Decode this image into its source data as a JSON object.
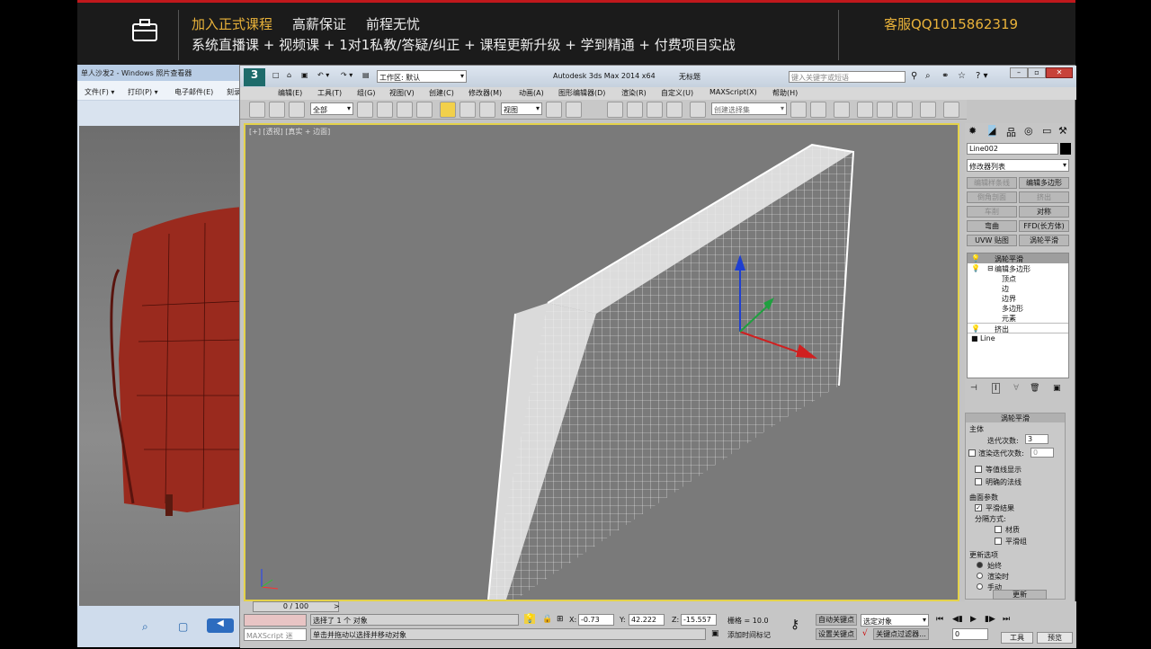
{
  "banner": {
    "line1": [
      "加入正式课程",
      "高薪保证",
      "前程无忧"
    ],
    "line2": "系统直播课 + 视频课 + 1对1私教/答疑/纠正 + 课程更新升级 + 学到精通 + 付费项目实战",
    "contact": "客服QQ1015862319"
  },
  "photo_viewer": {
    "title": "单人沙发2 - Windows 照片查看器",
    "menu": [
      "文件(F) ▾",
      "打印(P) ▾",
      "电子邮件(E)",
      "刻录"
    ]
  },
  "app": {
    "title": "Autodesk 3ds Max  2014 x64",
    "doc": "无标题",
    "workspace": "工作区: 默认",
    "search_placeholder": "键入关键字或短语",
    "menu": [
      "编辑(E)",
      "工具(T)",
      "组(G)",
      "视图(V)",
      "创建(C)",
      "修改器(M)",
      "动画(A)",
      "图形编辑器(D)",
      "渲染(R)",
      "自定义(U)",
      "MAXScript(X)",
      "帮助(H)"
    ],
    "selection_filter": "全部",
    "ref_coord": "视图",
    "named_selection": "创建选择集",
    "viewport_label": "[+] [透视] [真实 + 边面]"
  },
  "command_panel": {
    "object_name": "Line002",
    "modifier_list": "修改器列表",
    "buttons": [
      {
        "label": "编辑样条线",
        "dim": true
      },
      {
        "label": "编辑多边形",
        "dim": false
      },
      {
        "label": "倒角剖面",
        "dim": true
      },
      {
        "label": "挤出",
        "dim": true
      },
      {
        "label": "车削",
        "dim": true
      },
      {
        "label": "对称",
        "dim": false
      },
      {
        "label": "弯曲",
        "dim": false
      },
      {
        "label": "FFD(长方体)",
        "dim": false
      },
      {
        "label": "UVW 贴图",
        "dim": false
      },
      {
        "label": "涡轮平滑",
        "dim": false
      }
    ],
    "stack": [
      "涡轮平滑",
      "编辑多边形",
      "顶点",
      "边",
      "边界",
      "多边形",
      "元素",
      "挤出",
      "Line"
    ],
    "turbosmooth": {
      "title": "涡轮平滑",
      "main": "主体",
      "iterations_label": "迭代次数:",
      "iterations": "3",
      "render_iters_label": "渲染迭代次数:",
      "render_iters": "0",
      "isoline": "等值线显示",
      "explicit_normals": "明确的法线",
      "surface_params": "曲面参数",
      "smooth_result": "平滑结果",
      "separate_by": "分隔方式:",
      "materials": "材质",
      "smoothing_groups": "平滑组",
      "update_options": "更新选项",
      "always": "始终",
      "when_rendering": "渲染时",
      "manually": "手动",
      "update_btn": "更新"
    }
  },
  "status": {
    "timeline": "0 / 100",
    "selected": "选择了 1 个 对象",
    "hint": "单击并拖动以选择并移动对象",
    "maxscript": "MAXScript 迷",
    "x_label": "X:",
    "x": "-0.73",
    "y_label": "Y:",
    "y": "42.222",
    "z_label": "Z:",
    "z": "-15.557",
    "grid": "栅格 = 10.0",
    "add_time_tag": "添加时间标记",
    "auto_key": "自动关键点",
    "set_key": "设置关键点",
    "selected_obj": "选定对象",
    "key_filters": "关键点过滤器...",
    "frame": "0"
  },
  "taskbar": {
    "tools": "工具",
    "preview": "预览"
  }
}
